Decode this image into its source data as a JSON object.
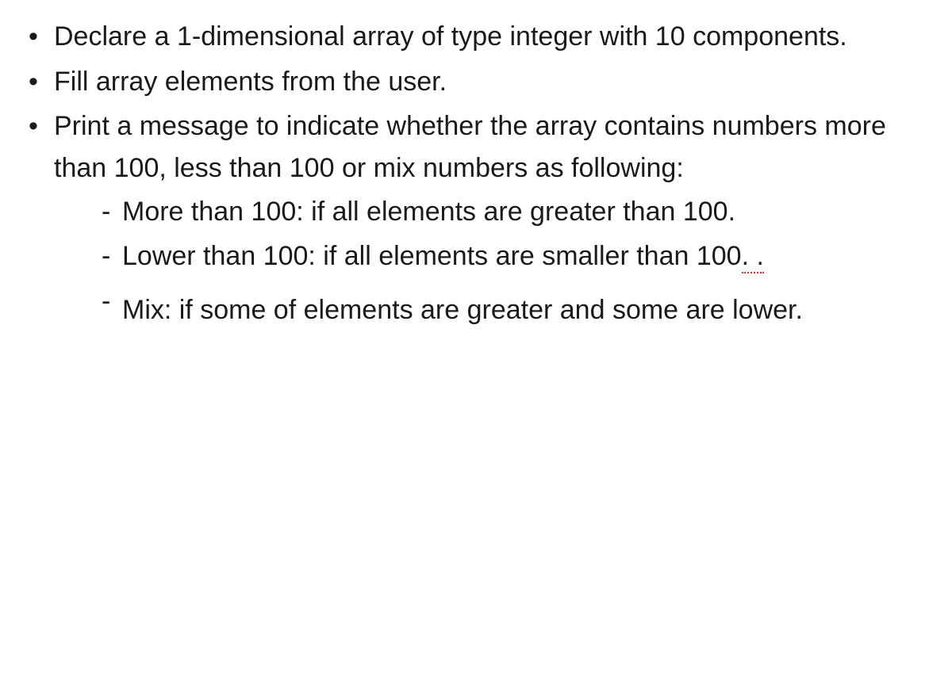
{
  "bullets": [
    {
      "text": "Declare a 1-dimensional array of type integer with 10 components."
    },
    {
      "text": "Fill array elements from the user."
    },
    {
      "text": "Print a message to indicate whether the array contains numbers more than 100, less than 100 or mix numbers as following:",
      "sub": [
        {
          "lead": "More than 100: if all elements are greater than ",
          "trail": "100."
        },
        {
          "lead": "Lower than 100: if all elements are smaller than ",
          "trail_pre": "100",
          "trail_squiggle": ". ."
        },
        {
          "lead": "Mix: if some of elements are greater and some are lower."
        }
      ]
    }
  ]
}
